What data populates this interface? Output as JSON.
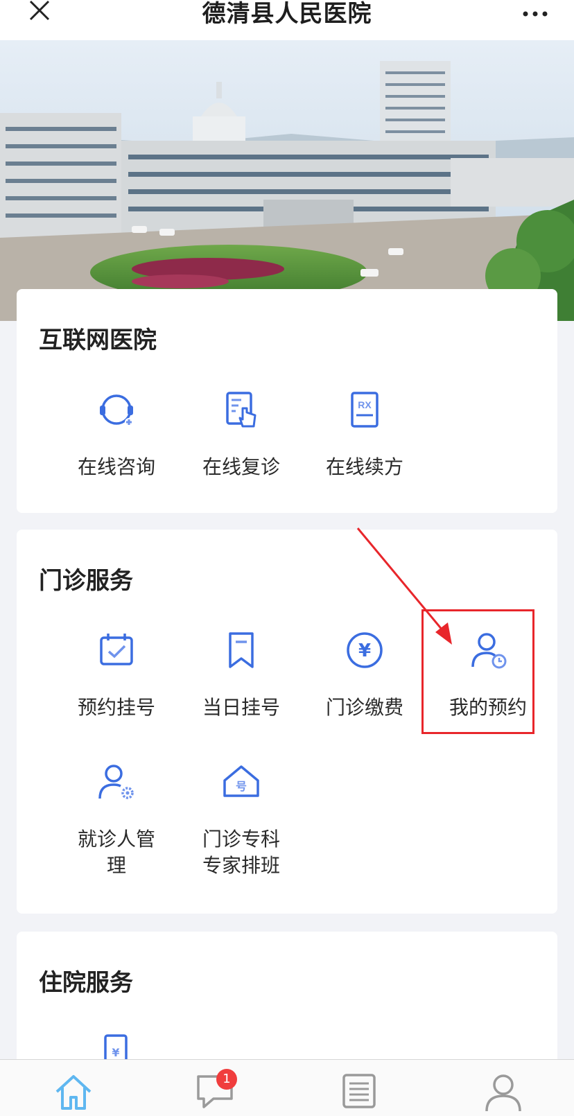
{
  "header": {
    "title": "德清县人民医院",
    "close_icon": "close-icon",
    "more_icon": "more-icon"
  },
  "banner": {
    "alt": "hospital-building-photo"
  },
  "sections": [
    {
      "title": "互联网医院",
      "items": [
        {
          "label": "在线咨询",
          "icon": "headset-icon"
        },
        {
          "label": "在线复诊",
          "icon": "touch-document-icon"
        },
        {
          "label": "在线续方",
          "icon": "rx-prescription-icon",
          "icon_text": "RX"
        }
      ]
    },
    {
      "title": "门诊服务",
      "items": [
        {
          "label": "预约挂号",
          "icon": "calendar-check-icon"
        },
        {
          "label": "当日挂号",
          "icon": "bookmark-icon"
        },
        {
          "label": "门诊缴费",
          "icon": "yuan-coin-icon",
          "icon_text": "¥"
        },
        {
          "label": "我的预约",
          "icon": "user-clock-icon"
        },
        {
          "label": "就诊人管理",
          "icon": "user-gear-icon"
        },
        {
          "label": "门诊专科专家排班",
          "icon": "house-number-icon",
          "icon_text": "号"
        }
      ]
    },
    {
      "title": "住院服务",
      "items": [
        {
          "label": "",
          "icon": "inpatient-icon",
          "icon_text": "¥"
        }
      ]
    }
  ],
  "tabbar": {
    "tabs": [
      {
        "icon": "home-icon"
      },
      {
        "icon": "message-icon",
        "badge": "1"
      },
      {
        "icon": "list-icon"
      },
      {
        "icon": "profile-icon"
      }
    ]
  },
  "colors": {
    "accent": "#3b6de0",
    "badge": "#f03d3d",
    "annotation": "#e8262b"
  }
}
